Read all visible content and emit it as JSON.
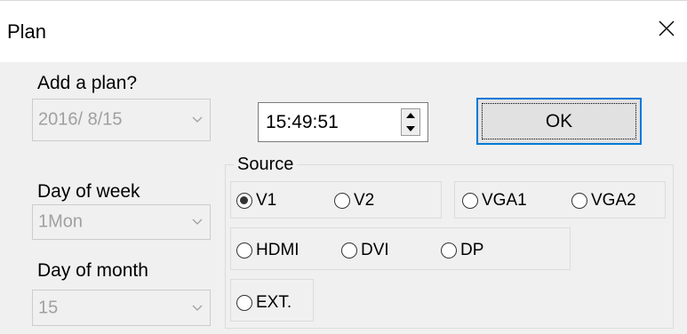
{
  "window": {
    "title": "Plan"
  },
  "form": {
    "add_plan_label": "Add a plan?",
    "date_value": "2016/  8/15",
    "time_value": "15:49:51",
    "ok_label": "OK",
    "day_of_week_label": "Day of week",
    "day_of_week_value": "1Mon",
    "day_of_month_label": "Day of month",
    "day_of_month_value": "15"
  },
  "source": {
    "title": "Source",
    "options": [
      {
        "label": "V1",
        "checked": true
      },
      {
        "label": "V2",
        "checked": false
      },
      {
        "label": "VGA1",
        "checked": false
      },
      {
        "label": "VGA2",
        "checked": false
      },
      {
        "label": "HDMI",
        "checked": false
      },
      {
        "label": "DVI",
        "checked": false
      },
      {
        "label": "DP",
        "checked": false
      },
      {
        "label": "EXT.",
        "checked": false
      }
    ]
  }
}
